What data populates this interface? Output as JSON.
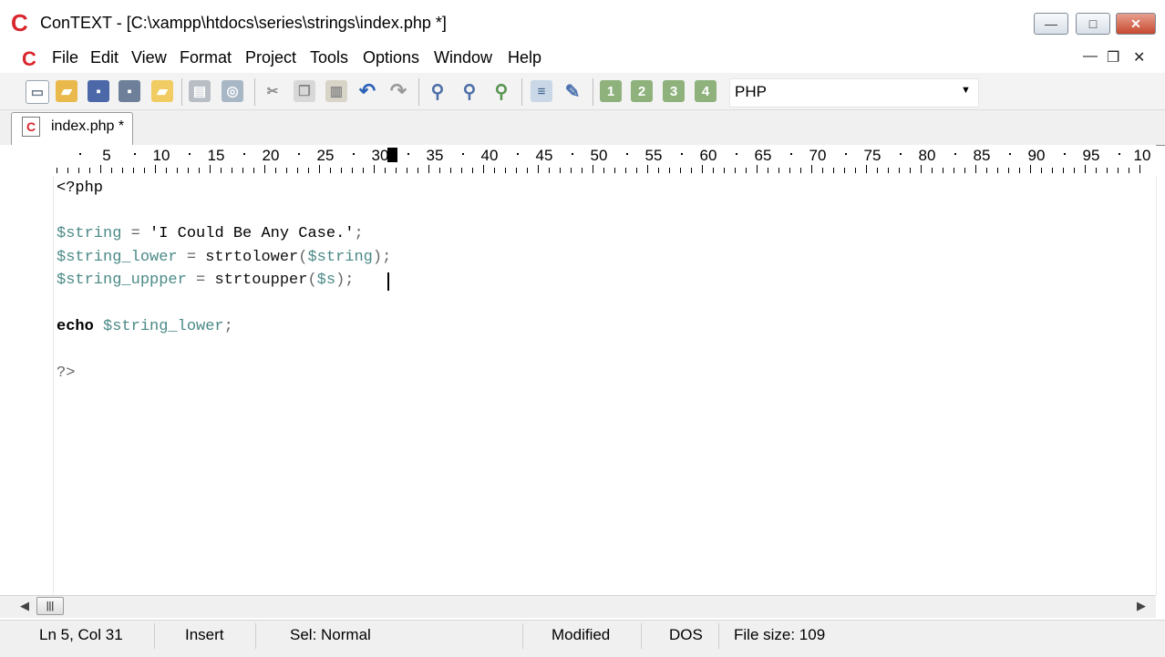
{
  "window": {
    "app_logo": "C",
    "title": "ConTEXT - [C:\\xampp\\htdocs\\series\\strings\\index.php *]",
    "minimize": "—",
    "maximize": "□",
    "close": "✕"
  },
  "menubar": {
    "logo": "C",
    "items": [
      "File",
      "Edit",
      "View",
      "Format",
      "Project",
      "Tools",
      "Options",
      "Window",
      "Help"
    ],
    "mdi_minimize": "—",
    "mdi_restore": "❐",
    "mdi_close": "✕"
  },
  "toolbar": {
    "icons": [
      "new-file-icon",
      "open-folder-icon",
      "save-icon",
      "save-all-icon",
      "open-project-icon",
      "print-icon",
      "print-preview-icon",
      "cut-icon",
      "copy-icon",
      "paste-icon",
      "undo-icon",
      "redo-icon",
      "find-icon",
      "find-next-icon",
      "replace-icon",
      "file-compare-icon",
      "tools-icon",
      "user-command-1-icon",
      "user-command-2-icon",
      "user-command-3-icon",
      "user-command-4-icon"
    ],
    "highlighter": "PHP"
  },
  "tabs": [
    {
      "label": "index.php *",
      "icon": "C"
    }
  ],
  "ruler": {
    "labels": [
      "5",
      "10",
      "15",
      "20",
      "25",
      "30",
      "35",
      "40",
      "45",
      "50",
      "55",
      "60",
      "65",
      "70",
      "75",
      "80",
      "85",
      "90",
      "95",
      "10"
    ],
    "cursor_column": 31
  },
  "editor": {
    "lines": [
      "<?php",
      "",
      "$string = 'I Could Be Any Case.';",
      "$string_lower = strtolower($string);",
      "$string_uppper = strtoupper($s);",
      "",
      "echo $string_lower;",
      "",
      "?>"
    ]
  },
  "colors": {
    "variable": "#4b8a87",
    "logo": "#d8262c"
  },
  "statusbar": {
    "position": "Ln 5, Col 31",
    "mode": "Insert",
    "selection": "Sel: Normal",
    "modified": "Modified",
    "line_endings": "DOS",
    "file_size": "File size: 109"
  }
}
